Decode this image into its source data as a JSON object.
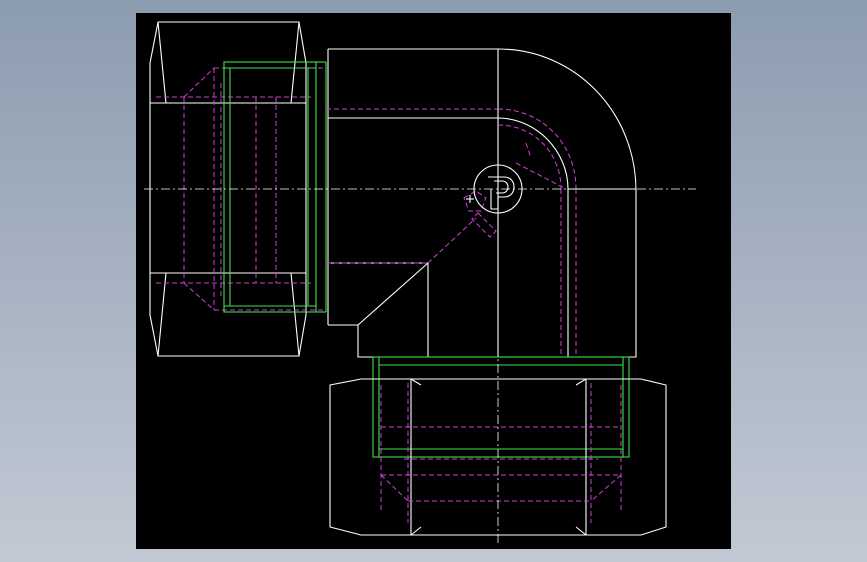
{
  "window": {
    "background_top": "#8c9cb0",
    "background_bottom": "#c2c9d4"
  },
  "viewport": {
    "background": "#000000",
    "colors": {
      "visible_edge": "#ffffff",
      "thread_edge": "#3fe04a",
      "hidden_edge": "#d040d8",
      "centerline": "#ffffff"
    }
  },
  "drawing": {
    "subject": "elbow-fitting",
    "logo_icon": "parker-p-logo-icon"
  }
}
